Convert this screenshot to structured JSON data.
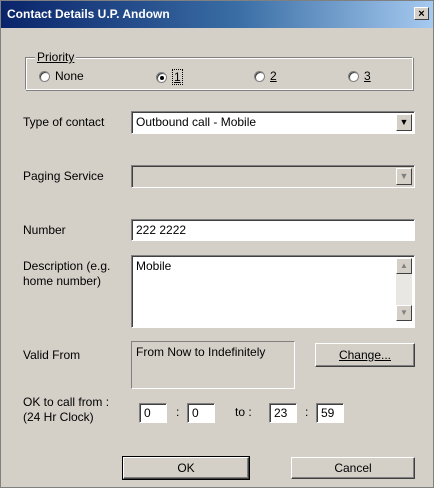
{
  "window": {
    "title": "Contact Details U.P. Andown",
    "close_glyph": "×"
  },
  "priority": {
    "group_label": "Priority",
    "options": [
      {
        "label": "None",
        "selected": false
      },
      {
        "label": "1",
        "selected": true
      },
      {
        "label": "2",
        "selected": false
      },
      {
        "label": "3",
        "selected": false
      }
    ]
  },
  "type_of_contact": {
    "label": "Type of contact",
    "value": "Outbound call - Mobile"
  },
  "paging_service": {
    "label": "Paging Service",
    "value": ""
  },
  "number": {
    "label": "Number",
    "value": "222 2222"
  },
  "description": {
    "label_line1": "Description (e.g.",
    "label_line2": "home number)",
    "value": "Mobile"
  },
  "valid_from": {
    "label": "Valid From",
    "value": "From Now to Indefinitely",
    "change_button": "Change..."
  },
  "ok_to_call": {
    "label_line1": "OK to call from :",
    "label_line2": "(24 Hr Clock)",
    "from_hour": "0",
    "from_min": "0",
    "to_label": "to :",
    "to_hour": "23",
    "to_min": "59",
    "sep": ":"
  },
  "buttons": {
    "ok": "OK",
    "cancel": "Cancel"
  },
  "icons": {
    "dropdown": "dropdown-arrow-icon",
    "close": "close-icon"
  }
}
